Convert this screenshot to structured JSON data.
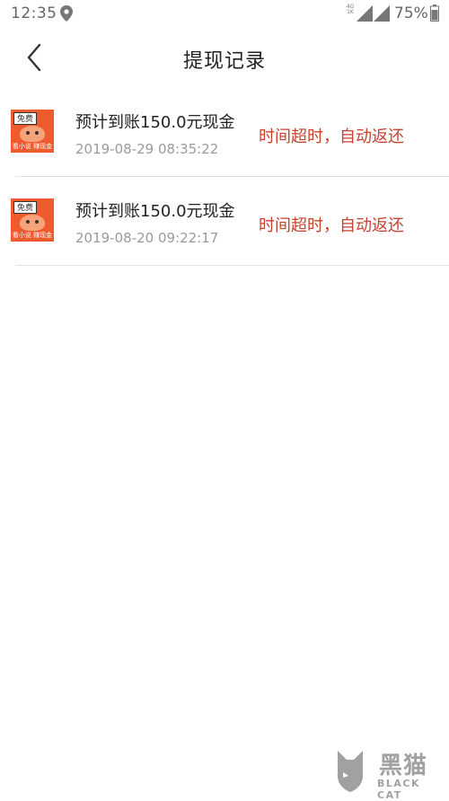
{
  "status_bar": {
    "time": "12:35",
    "network_top": "4G",
    "network_bottom": "1K",
    "battery": "75%"
  },
  "header": {
    "title": "提现记录"
  },
  "app_icon": {
    "badge": "免费",
    "caption": "看小说 赚现金"
  },
  "records": [
    {
      "title": "预计到账150.0元现金",
      "time": "2019-08-29 08:35:22",
      "status": "时间超时，自动返还"
    },
    {
      "title": "预计到账150.0元现金",
      "time": "2019-08-20 09:22:17",
      "status": "时间超时，自动返还"
    }
  ],
  "watermark": {
    "name_cn": "黑猫",
    "name_en": "BLACK CAT"
  },
  "colors": {
    "status_red": "#c9412f",
    "icon_orange": "#ef5a2e"
  }
}
